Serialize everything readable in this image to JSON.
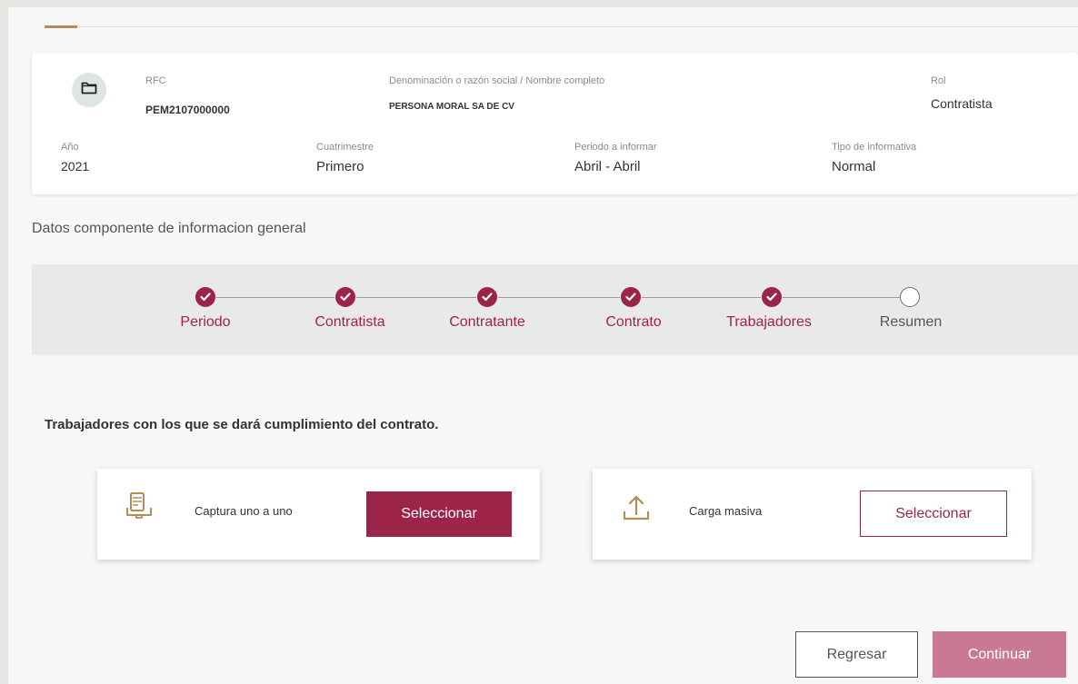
{
  "header": {
    "rfc_label": "RFC",
    "rfc_value": "PEM2107000000",
    "razon_label": "Denominación o razón social / Nombre completo",
    "razon_value": "PERSONA MORAL SA DE CV",
    "rol_label": "Rol",
    "rol_value": "Contratista",
    "anio_label": "Año",
    "anio_value": "2021",
    "cuatrimestre_label": "Cuatrimestre",
    "cuatrimestre_value": "Primero",
    "periodo_label": "Periodo a informar",
    "periodo_value": "Abril - Abril",
    "tipo_label": "Tipo de informativa",
    "tipo_value": "Normal",
    "icon": "folder-icon"
  },
  "section_title": "Datos componente de informacion general",
  "stepper": {
    "steps": [
      {
        "label": "Periodo",
        "status": "done"
      },
      {
        "label": "Contratista",
        "status": "done"
      },
      {
        "label": "Contratante",
        "status": "done"
      },
      {
        "label": "Contrato",
        "status": "done"
      },
      {
        "label": "Trabajadores",
        "status": "done"
      },
      {
        "label": "Resumen",
        "status": "pending"
      }
    ]
  },
  "instruction": "Trabajadores con los que se dará cumplimiento del contrato.",
  "options": {
    "manual": {
      "label": "Captura uno a uno",
      "button": "Seleccionar",
      "icon": "keyboard-capture-icon"
    },
    "bulk": {
      "label": "Carga masiva",
      "button": "Seleccionar",
      "icon": "upload-icon"
    }
  },
  "footer": {
    "back": "Regresar",
    "continue": "Continuar"
  },
  "colors": {
    "accent": "#9d2449",
    "gold": "#b28d5a",
    "muted_accent": "#c97a92"
  }
}
